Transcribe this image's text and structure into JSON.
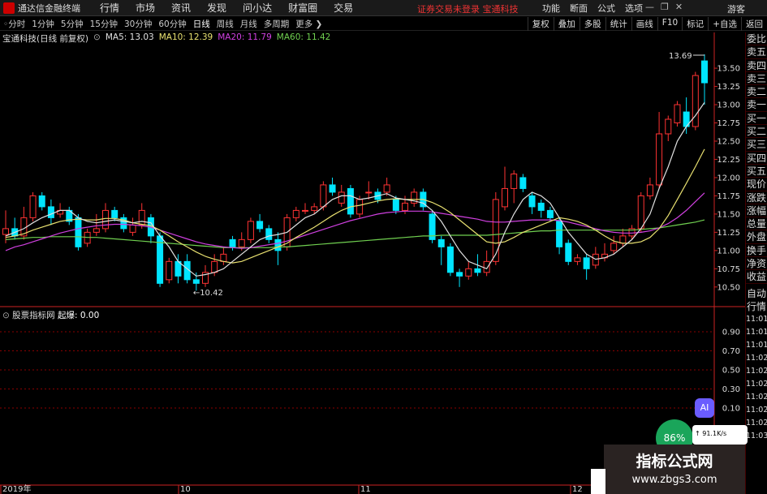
{
  "menubar": {
    "app_title": "通达信金融终端",
    "items": [
      "行情",
      "市场",
      "资讯",
      "发现",
      "问小达",
      "财富圈",
      "交易"
    ],
    "notice": "证券交易未登录  宝通科技",
    "right_items": [
      "功能",
      "断面",
      "公式",
      "选项"
    ],
    "guest": "游客"
  },
  "toolbar": {
    "periods": [
      "分时",
      "1分钟",
      "5分钟",
      "15分钟",
      "30分钟",
      "60分钟",
      "日线",
      "周线",
      "月线",
      "多周期",
      "更多"
    ],
    "active": "日线",
    "right_buttons": [
      "复权",
      "叠加",
      "多股",
      "统计",
      "画线",
      "F10",
      "标记",
      "+自选",
      "返回"
    ]
  },
  "info": {
    "stock": "宝通科技(日线 前复权)",
    "ma5": "MA5: 13.03",
    "ma10": "MA10: 12.39",
    "ma20": "MA20: 11.79",
    "ma60": "MA60: 11.42"
  },
  "colors": {
    "up": "#ff3333",
    "down": "#00e5ff",
    "ma5": "#e0e0e0",
    "ma10": "#e8e070",
    "ma20": "#d040e0",
    "ma60": "#70d050",
    "grid": "#8a0000",
    "axis": "#cc2222"
  },
  "side_panel": {
    "labels": [
      "委比",
      "卖五",
      "卖四",
      "卖三",
      "卖二",
      "卖一",
      "买一",
      "买二",
      "买三",
      "买四",
      "买五",
      "现价",
      "涨跌",
      "涨幅",
      "总量",
      "外盘",
      "换手",
      "净资",
      "收益"
    ],
    "labels2": [
      "自动",
      "行情"
    ],
    "times": [
      "11:01",
      "11:01",
      "11:01",
      "11:02",
      "11:02",
      "11:02",
      "11:02",
      "11:02",
      "11:02",
      "11:03"
    ]
  },
  "indicator": {
    "name": "股票指标网",
    "label": "起爆: 0.00"
  },
  "chart_data": {
    "type": "candlestick",
    "y_ticks": [
      13.5,
      13.25,
      13.0,
      12.75,
      12.5,
      12.25,
      12.0,
      11.75,
      11.5,
      11.25,
      11.0,
      10.75,
      10.5
    ],
    "sub_y_ticks": [
      0.9,
      0.7,
      0.5,
      0.3,
      0.1
    ],
    "x_labels": [
      "2019年",
      "10",
      "11",
      "12"
    ],
    "annotations": {
      "high": "13.69",
      "low": "←10.42"
    },
    "candles": [
      [
        11.22,
        11.3,
        11.55,
        11.1
      ],
      [
        11.3,
        11.2,
        11.45,
        11.15
      ],
      [
        11.2,
        11.45,
        11.6,
        11.15
      ],
      [
        11.45,
        11.75,
        11.8,
        11.4
      ],
      [
        11.75,
        11.6,
        11.8,
        11.55
      ],
      [
        11.6,
        11.45,
        11.7,
        11.35
      ],
      [
        11.5,
        11.55,
        11.65,
        11.45
      ],
      [
        11.55,
        11.4,
        11.6,
        11.35
      ],
      [
        11.45,
        11.05,
        11.5,
        11.0
      ],
      [
        11.1,
        11.25,
        11.3,
        11.05
      ],
      [
        11.25,
        11.3,
        11.5,
        11.2
      ],
      [
        11.3,
        11.55,
        11.65,
        11.25
      ],
      [
        11.55,
        11.45,
        11.6,
        11.4
      ],
      [
        11.45,
        11.3,
        11.5,
        11.25
      ],
      [
        11.25,
        11.35,
        11.45,
        11.2
      ],
      [
        11.35,
        11.55,
        11.65,
        11.3
      ],
      [
        11.45,
        11.2,
        11.5,
        11.1
      ],
      [
        11.2,
        10.55,
        11.25,
        10.5
      ],
      [
        10.6,
        10.85,
        10.9,
        10.55
      ],
      [
        10.85,
        10.65,
        10.95,
        10.55
      ],
      [
        10.85,
        10.6,
        10.95,
        10.55
      ],
      [
        10.6,
        10.55,
        10.7,
        10.45
      ],
      [
        10.55,
        10.7,
        10.8,
        10.5
      ],
      [
        10.7,
        10.85,
        10.95,
        10.65
      ],
      [
        10.85,
        10.95,
        11.05,
        10.8
      ],
      [
        11.15,
        11.05,
        11.2,
        11.0
      ],
      [
        11.05,
        11.15,
        11.25,
        11.0
      ],
      [
        11.15,
        11.4,
        11.45,
        11.1
      ],
      [
        11.4,
        11.3,
        11.5,
        11.25
      ],
      [
        11.3,
        11.15,
        11.35,
        11.1
      ],
      [
        11.15,
        11.0,
        11.25,
        10.8
      ],
      [
        11.05,
        11.45,
        11.5,
        11.0
      ],
      [
        11.45,
        11.55,
        11.6,
        11.4
      ],
      [
        11.55,
        11.55,
        11.65,
        11.5
      ],
      [
        11.55,
        11.6,
        11.65,
        11.5
      ],
      [
        11.6,
        11.9,
        11.95,
        11.55
      ],
      [
        11.9,
        11.8,
        12.0,
        11.75
      ],
      [
        11.65,
        11.8,
        11.9,
        11.6
      ],
      [
        11.85,
        11.5,
        11.9,
        11.45
      ],
      [
        11.5,
        11.7,
        11.75,
        11.45
      ],
      [
        11.8,
        11.8,
        11.95,
        11.7
      ],
      [
        11.8,
        11.7,
        11.85,
        11.65
      ],
      [
        11.8,
        11.9,
        12.0,
        11.75
      ],
      [
        11.7,
        11.55,
        11.75,
        11.5
      ],
      [
        11.55,
        11.65,
        11.75,
        11.5
      ],
      [
        11.65,
        11.8,
        11.85,
        11.6
      ],
      [
        11.8,
        11.6,
        11.85,
        11.55
      ],
      [
        11.5,
        11.15,
        11.55,
        11.1
      ],
      [
        11.15,
        11.05,
        11.2,
        10.8
      ],
      [
        11.05,
        10.7,
        11.1,
        10.65
      ],
      [
        10.7,
        10.65,
        10.75,
        10.5
      ],
      [
        10.65,
        10.75,
        10.85,
        10.6
      ],
      [
        10.75,
        10.7,
        10.95,
        10.65
      ],
      [
        10.7,
        10.85,
        11.0,
        10.65
      ],
      [
        10.85,
        11.7,
        11.8,
        10.8
      ],
      [
        11.6,
        11.85,
        12.15,
        11.55
      ],
      [
        11.85,
        12.05,
        12.1,
        11.65
      ],
      [
        12.0,
        11.85,
        12.05,
        11.8
      ],
      [
        11.75,
        11.6,
        11.8,
        11.5
      ],
      [
        11.65,
        11.55,
        11.7,
        11.45
      ],
      [
        11.55,
        11.45,
        11.6,
        11.4
      ],
      [
        11.4,
        11.05,
        11.45,
        10.95
      ],
      [
        11.1,
        10.85,
        11.15,
        10.8
      ],
      [
        10.85,
        10.9,
        10.95,
        10.8
      ],
      [
        10.9,
        10.75,
        10.95,
        10.6
      ],
      [
        10.8,
        10.95,
        11.05,
        10.75
      ],
      [
        10.9,
        10.95,
        11.1,
        10.85
      ],
      [
        11.0,
        11.1,
        11.2,
        10.95
      ],
      [
        11.1,
        11.2,
        11.3,
        11.05
      ],
      [
        11.2,
        11.3,
        11.35,
        11.15
      ],
      [
        11.3,
        11.75,
        11.8,
        11.25
      ],
      [
        11.75,
        11.9,
        12.0,
        11.7
      ],
      [
        11.9,
        12.6,
        12.9,
        11.85
      ],
      [
        12.6,
        12.8,
        12.85,
        12.5
      ],
      [
        12.75,
        13.0,
        13.05,
        12.7
      ],
      [
        12.9,
        12.7,
        13.1,
        12.6
      ],
      [
        12.7,
        13.4,
        13.45,
        12.65
      ],
      [
        13.6,
        13.3,
        13.69,
        13.0
      ]
    ],
    "ma5": [
      11.2,
      11.25,
      11.3,
      11.38,
      11.45,
      11.5,
      11.55,
      11.55,
      11.45,
      11.4,
      11.38,
      11.4,
      11.42,
      11.4,
      11.38,
      11.4,
      11.38,
      11.2,
      11.05,
      10.85,
      10.75,
      10.65,
      10.67,
      10.7,
      10.75,
      10.85,
      10.95,
      11.05,
      11.15,
      11.2,
      11.22,
      11.25,
      11.35,
      11.45,
      11.5,
      11.6,
      11.7,
      11.75,
      11.75,
      11.7,
      11.72,
      11.75,
      11.78,
      11.72,
      11.7,
      11.68,
      11.65,
      11.55,
      11.4,
      11.2,
      11.0,
      10.85,
      10.8,
      10.75,
      10.95,
      11.25,
      11.5,
      11.7,
      11.8,
      11.75,
      11.65,
      11.45,
      11.25,
      11.1,
      10.95,
      10.88,
      10.9,
      10.95,
      11.05,
      11.15,
      11.3,
      11.5,
      11.85,
      12.15,
      12.5,
      12.7,
      12.85,
      13.03
    ],
    "ma10": [
      11.18,
      11.2,
      11.23,
      11.28,
      11.32,
      11.36,
      11.4,
      11.42,
      11.43,
      11.42,
      11.42,
      11.44,
      11.44,
      11.42,
      11.38,
      11.36,
      11.34,
      11.28,
      11.2,
      11.12,
      11.05,
      10.98,
      10.92,
      10.88,
      10.85,
      10.83,
      10.85,
      10.9,
      10.95,
      11.0,
      11.05,
      11.1,
      11.18,
      11.25,
      11.32,
      11.4,
      11.48,
      11.55,
      11.6,
      11.62,
      11.65,
      11.68,
      11.7,
      11.71,
      11.7,
      11.7,
      11.7,
      11.66,
      11.6,
      11.52,
      11.42,
      11.32,
      11.22,
      11.12,
      11.1,
      11.12,
      11.18,
      11.25,
      11.3,
      11.35,
      11.4,
      11.45,
      11.43,
      11.4,
      11.35,
      11.28,
      11.2,
      11.13,
      11.1,
      11.1,
      11.12,
      11.18,
      11.3,
      11.48,
      11.7,
      11.92,
      12.15,
      12.39
    ],
    "ma20": [
      11.0,
      11.05,
      11.08,
      11.12,
      11.16,
      11.2,
      11.24,
      11.27,
      11.3,
      11.32,
      11.34,
      11.35,
      11.36,
      11.36,
      11.35,
      11.34,
      11.32,
      11.28,
      11.24,
      11.2,
      11.16,
      11.12,
      11.09,
      11.07,
      11.05,
      11.04,
      11.03,
      11.04,
      11.06,
      11.08,
      11.1,
      11.13,
      11.17,
      11.21,
      11.25,
      11.29,
      11.33,
      11.37,
      11.41,
      11.44,
      11.47,
      11.5,
      11.52,
      11.53,
      11.54,
      11.54,
      11.54,
      11.53,
      11.51,
      11.49,
      11.47,
      11.45,
      11.43,
      11.4,
      11.39,
      11.39,
      11.4,
      11.41,
      11.42,
      11.42,
      11.42,
      11.41,
      11.39,
      11.36,
      11.33,
      11.3,
      11.27,
      11.25,
      11.24,
      11.24,
      11.25,
      11.27,
      11.31,
      11.37,
      11.45,
      11.55,
      11.67,
      11.79
    ],
    "ma60": [
      11.15,
      11.16,
      11.17,
      11.18,
      11.18,
      11.19,
      11.19,
      11.19,
      11.19,
      11.18,
      11.18,
      11.17,
      11.16,
      11.15,
      11.14,
      11.13,
      11.12,
      11.11,
      11.1,
      11.09,
      11.08,
      11.07,
      11.06,
      11.05,
      11.04,
      11.04,
      11.04,
      11.04,
      11.04,
      11.04,
      11.05,
      11.05,
      11.06,
      11.07,
      11.08,
      11.09,
      11.1,
      11.11,
      11.12,
      11.13,
      11.14,
      11.15,
      11.16,
      11.17,
      11.18,
      11.19,
      11.2,
      11.2,
      11.21,
      11.21,
      11.21,
      11.21,
      11.21,
      11.21,
      11.22,
      11.23,
      11.24,
      11.25,
      11.26,
      11.27,
      11.27,
      11.28,
      11.28,
      11.28,
      11.28,
      11.28,
      11.28,
      11.28,
      11.28,
      11.28,
      11.29,
      11.3,
      11.31,
      11.33,
      11.35,
      11.37,
      11.39,
      11.42
    ]
  },
  "overlay": {
    "ai": "AI",
    "speed": "86",
    "speed_card": "91.1K/s",
    "watermark_title": "指标公式网",
    "watermark_url": "www.zbgs3.com"
  }
}
